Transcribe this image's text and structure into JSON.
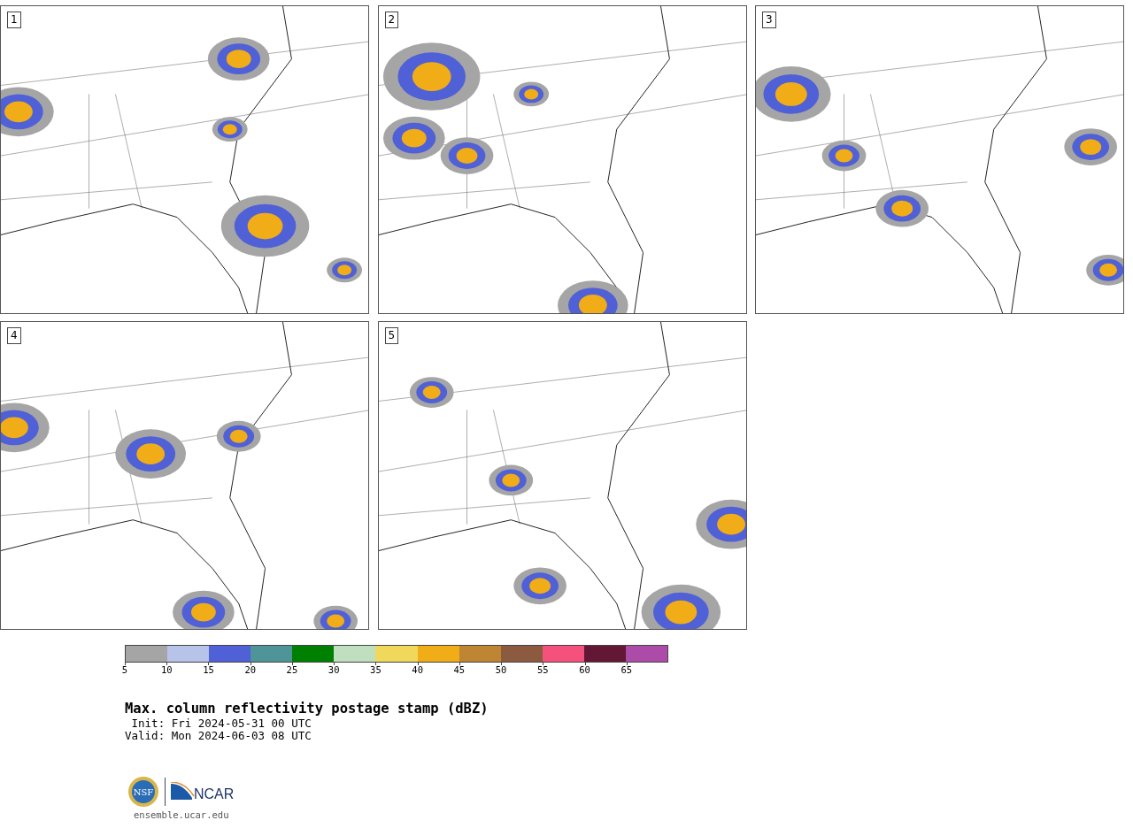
{
  "panels": [
    {
      "label": "1"
    },
    {
      "label": "2"
    },
    {
      "label": "3"
    },
    {
      "label": "4"
    },
    {
      "label": "5"
    }
  ],
  "colorbar": {
    "segments": [
      {
        "color": "#a5a5a5"
      },
      {
        "color": "#b8c3ea"
      },
      {
        "color": "#5060d6"
      },
      {
        "color": "#4f9499"
      },
      {
        "color": "#008000"
      },
      {
        "color": "#bfdfbf"
      },
      {
        "color": "#f0d95a"
      },
      {
        "color": "#f0ad17"
      },
      {
        "color": "#be8532"
      },
      {
        "color": "#8b5a3f"
      },
      {
        "color": "#f4527c"
      },
      {
        "color": "#621734"
      },
      {
        "color": "#ad4ca8"
      }
    ],
    "ticks": [
      "5",
      "10",
      "15",
      "20",
      "25",
      "30",
      "35",
      "40",
      "45",
      "50",
      "55",
      "60",
      "65"
    ]
  },
  "title": "Max. column reflectivity postage stamp (dBZ)",
  "init": " Init: Fri 2024-05-31 00 UTC",
  "valid": "Valid: Mon 2024-06-03 08 UTC",
  "logos": {
    "nsf": "NSF",
    "ncar": "NCAR"
  },
  "site": "ensemble.ucar.edu"
}
